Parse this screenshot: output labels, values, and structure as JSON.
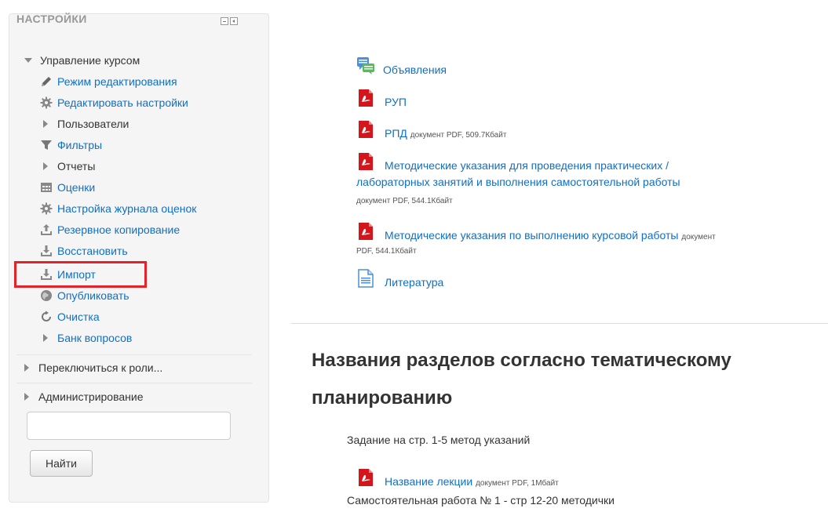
{
  "sidebar": {
    "title": "НАСТРОЙКИ",
    "course_admin": "Управление курсом",
    "items": [
      {
        "label": "Режим редактирования",
        "icon": "pencil-icon"
      },
      {
        "label": "Редактировать настройки",
        "icon": "gear-icon"
      },
      {
        "label": "Пользователи",
        "icon": "expand-arrow-icon"
      },
      {
        "label": "Фильтры",
        "icon": "filter-icon"
      },
      {
        "label": "Отчеты",
        "icon": "expand-arrow-icon"
      },
      {
        "label": "Оценки",
        "icon": "gradebook-icon"
      },
      {
        "label": "Настройка журнала оценок",
        "icon": "gear-icon"
      },
      {
        "label": "Резервное копирование",
        "icon": "upload-icon"
      },
      {
        "label": "Восстановить",
        "icon": "download-icon"
      },
      {
        "label": "Импорт",
        "icon": "download-icon"
      },
      {
        "label": "Опубликовать",
        "icon": "globe-icon"
      },
      {
        "label": "Очистка",
        "icon": "refresh-icon"
      },
      {
        "label": "Банк вопросов",
        "icon": "expand-arrow-icon"
      }
    ],
    "switch_role": "Переключиться к роли...",
    "administration": "Администрирование",
    "search": {
      "value": "",
      "placeholder": "",
      "button_label": "Найти"
    }
  },
  "resources": [
    {
      "label": "Объявления",
      "icon": "forum-icon"
    },
    {
      "label": "РУП",
      "icon": "pdf-icon"
    },
    {
      "label": "РПД",
      "meta": "документ PDF, 509.7Кбайт",
      "icon": "pdf-icon"
    },
    {
      "label_line1": "Методические указания для проведения практических /",
      "label_line2": "лабораторных занятий и выполнения самостоятельной работы",
      "meta": "документ PDF, 544.1Кбайт",
      "icon": "pdf-icon"
    },
    {
      "label": "Методические указания по выполнению курсовой работы",
      "meta_line1": "документ",
      "meta_line2": "PDF, 544.1Кбайт",
      "icon": "pdf-icon"
    },
    {
      "label": "Литература",
      "icon": "page-icon"
    }
  ],
  "section": {
    "title": "Названия разделов согласно тематическому планированию",
    "task_text": "Задание на стр. 1-5 метод указаний",
    "lecture_label": "Название лекции",
    "lecture_meta": "документ PDF, 1Мбайт",
    "selfwork_text": "Самостоятельная работа № 1 - стр 12-20 методички"
  },
  "colors": {
    "link": "#0f6fc5",
    "highlight": "#e2232a",
    "pdf_red": "#d4161c"
  }
}
